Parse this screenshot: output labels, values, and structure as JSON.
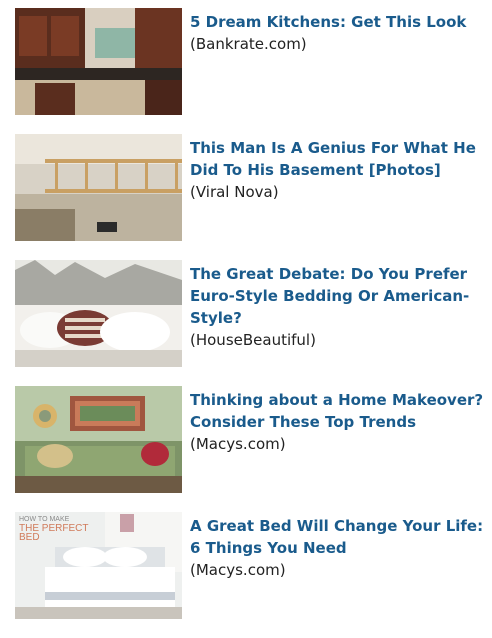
{
  "items": [
    {
      "headline": "5 Dream Kitchens: Get This Look",
      "source": "(Bankrate.com)"
    },
    {
      "headline": "This Man Is A Genius For What He Did To His Basement [Photos]",
      "source": "(Viral Nova)"
    },
    {
      "headline": "The Great Debate: Do You Prefer Euro-Style Bedding Or American-Style?",
      "source": "(HouseBeautiful)"
    },
    {
      "headline": "Thinking about a Home Makeover? Consider These Top Trends",
      "source": "(Macys.com)"
    },
    {
      "headline": "A Great Bed Will Change Your Life: 6 Things You Need",
      "source": "(Macys.com)"
    }
  ],
  "thumb_overlay_text": {
    "line1": "HOW TO MAKE",
    "line2": "THE PERFECT",
    "line3": "BED"
  },
  "colors": {
    "headline": "#1a5b8c",
    "source": "#222222"
  }
}
